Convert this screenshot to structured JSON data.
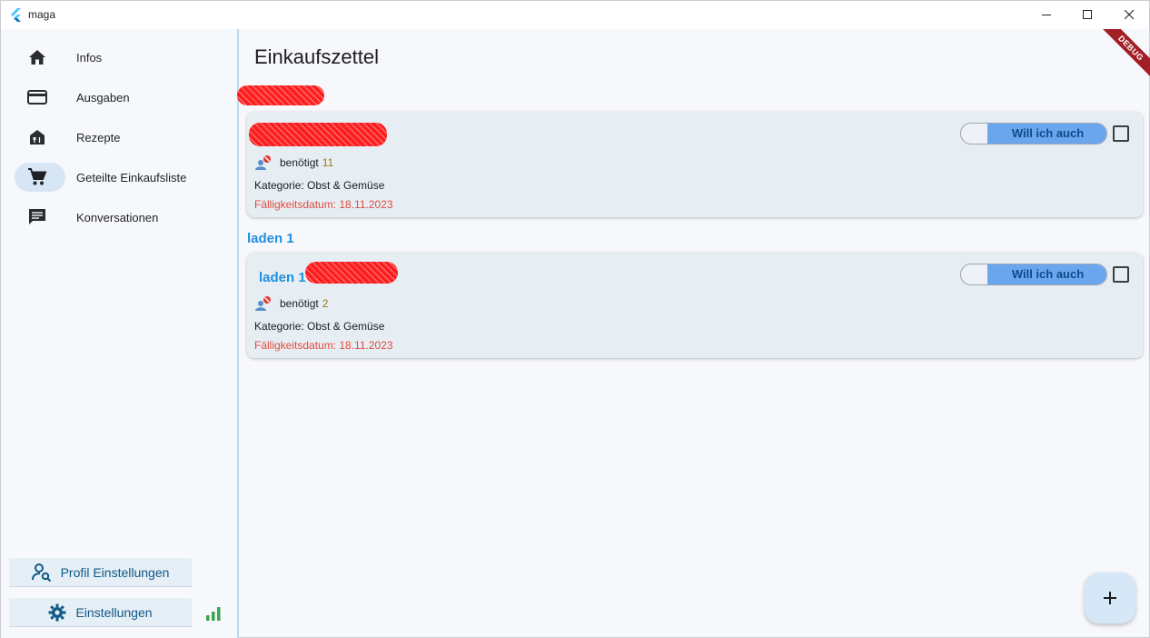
{
  "window": {
    "title": "maga",
    "icons": {
      "logo": "flutter-logo-icon",
      "minimize": "minimize-icon",
      "maximize": "maximize-icon",
      "close": "close-icon"
    }
  },
  "sidebar": {
    "items": [
      {
        "label": "Infos",
        "icon": "home-icon",
        "active": false
      },
      {
        "label": "Ausgaben",
        "icon": "credit-card-icon",
        "active": false
      },
      {
        "label": "Rezepte",
        "icon": "recipe-house-icon",
        "active": false
      },
      {
        "label": "Geteilte Einkaufsliste",
        "icon": "shopping-cart-icon",
        "active": true
      },
      {
        "label": "Konversationen",
        "icon": "chat-icon",
        "active": false
      }
    ],
    "profile_button": "Profil Einstellungen",
    "settings_button": "Einstellungen",
    "status_icon": "signal-bars-icon"
  },
  "main": {
    "title": "Einkaufszettel",
    "debug_banner": "DEBUG",
    "groups": [
      {
        "header": "",
        "header_redacted": true,
        "cards": [
          {
            "title": "",
            "title_redacted": true,
            "needed_label": "benötigt",
            "needed_count": "11",
            "category": "Kategorie: Obst & Gemüse",
            "due": "Fälligkeitsdatum: 18.11.2023",
            "toggle_label": "Will ich auch",
            "checked": false
          }
        ]
      },
      {
        "header": "laden 1",
        "cards": [
          {
            "title": "laden 1",
            "title_partially_redacted": true,
            "needed_label": "benötigt",
            "needed_count": "2",
            "category": "Kategorie: Obst & Gemüse",
            "due": "Fälligkeitsdatum: 18.11.2023",
            "toggle_label": "Will ich auch",
            "checked": false
          }
        ]
      }
    ],
    "fab_icon": "plus-icon"
  },
  "colors": {
    "accent": "#1e8fe0",
    "toggle_fill": "#6aa6ee",
    "due_date": "#e24a3e",
    "count": "#9a7b12",
    "debug": "#a31f26"
  }
}
